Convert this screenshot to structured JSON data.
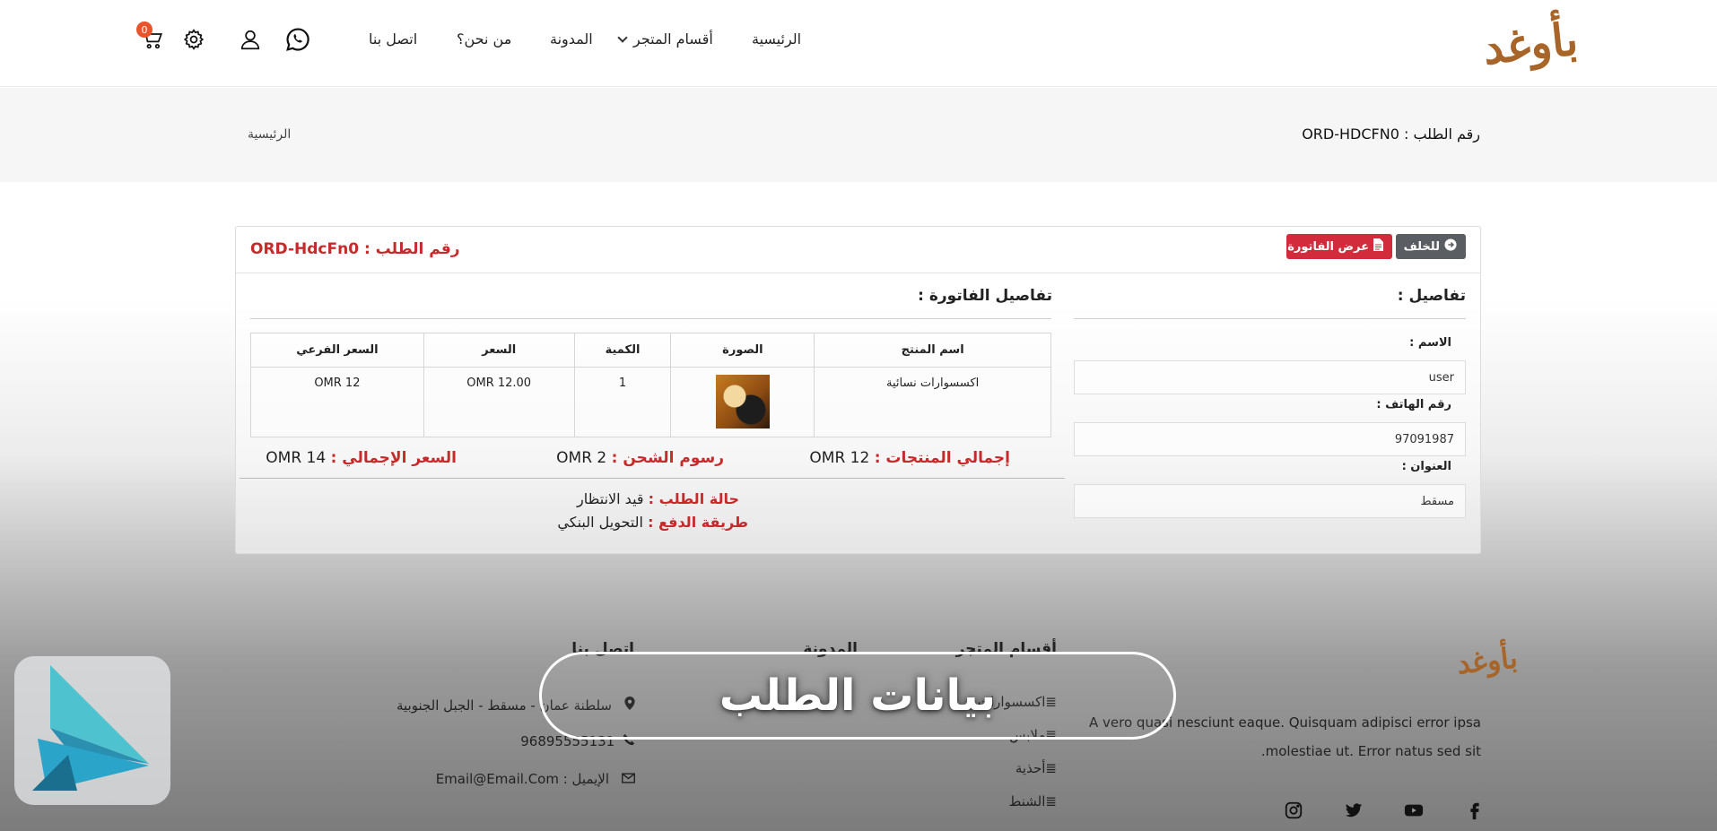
{
  "header": {
    "logo_text": "بأوغد",
    "nav": {
      "home": "الرئيسية",
      "store_sections": "أقسام المتجر",
      "blog": "المدونة",
      "about": "من نحن؟",
      "contact": "اتصل بنا"
    },
    "cart_count": "0"
  },
  "breadcrumb": {
    "order_label": "رقم الطلب : ORD-HDCFN0",
    "home": "الرئيسية"
  },
  "card": {
    "title": "رقم الطلب : ORD-HdcFn0",
    "back_button": "للخلف",
    "invoice_button": "عرض الفاتورة",
    "details_title": "تفاصيل :",
    "invoice_title": "تفاصيل الفاتورة :",
    "fields": {
      "name_label": "الاسم :",
      "name_value": "user",
      "phone_label": "رقم الهاتف :",
      "phone_value": "97091987",
      "address_label": "العنوان :",
      "address_value": "مسقط"
    },
    "table": {
      "headers": [
        "اسم المنتج",
        "الصورة",
        "الكمية",
        "السعر",
        "السعر الفرعي"
      ],
      "rows": [
        {
          "product": "اكسسوارات نسائية",
          "qty": "1",
          "price": "OMR 12.00",
          "subtotal": "OMR 12"
        }
      ]
    },
    "totals": {
      "products_label": "إجمالي المنتجات :",
      "products_value": "OMR 12",
      "shipping_label": "رسوم الشحن :",
      "shipping_value": "OMR 2",
      "total_label": "السعر الإجمالي :",
      "total_value": "OMR 14"
    },
    "status": {
      "order_status_label": "حالة الطلب :",
      "order_status_value": "قيد الانتظار",
      "payment_label": "طريقة الدفع :",
      "payment_value": "التحويل البنكي"
    }
  },
  "footer": {
    "logo_text": "بأوغد",
    "about_text_1": "A vero quasi nesciunt eaque. Quisquam adipisci error ipsa",
    "about_text_2": ".molestiae ut. Error natus sed sit",
    "col_store": "أقسام المتجر",
    "col_blog": "المدونة",
    "col_contact": "اتصل بنا",
    "store_links": [
      "اكسسوارات",
      "ملابس",
      "أحذية",
      "الشنط"
    ],
    "address": "سلطنة عمان - مسقط - الجبل الجنوبية",
    "phone": "96895555131",
    "email": "الإيميل : Email@Email.Com"
  },
  "overlay": {
    "banner_text": "بيانات الطلب"
  },
  "colors": {
    "accent_red": "#c62a2a",
    "invoice_button": "#d22b3b",
    "back_button": "#5a5e63",
    "logo_brown": "#a8652a",
    "badge": "#e8542c"
  }
}
